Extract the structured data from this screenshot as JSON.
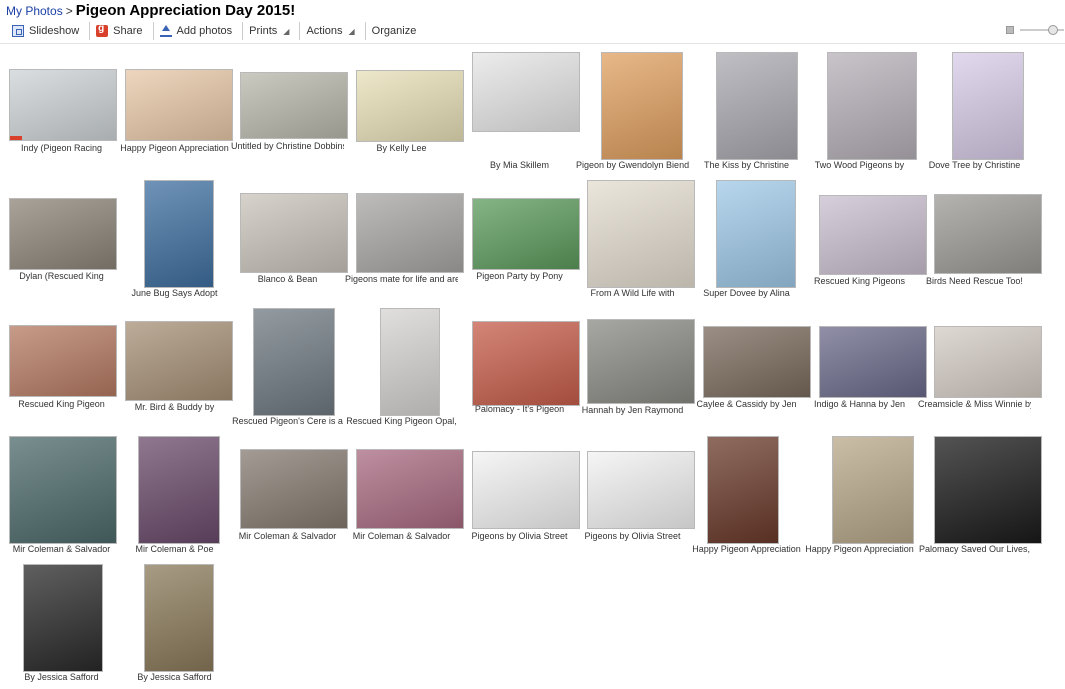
{
  "breadcrumb": {
    "root": "My Photos",
    "separator": ">",
    "album_title": "Pigeon Appreciation Day 2015!"
  },
  "toolbar": {
    "slideshow": "Slideshow",
    "share": "Share",
    "add_photos": "Add photos",
    "prints": "Prints",
    "actions": "Actions",
    "organize": "Organize"
  },
  "icons": {
    "slideshow": "slideshow-icon",
    "share": "google-plus-share-icon",
    "add_photos": "upload-icon",
    "thumb_small": "thumbnail-size-small-icon",
    "thumb_slider": "thumbnail-size-slider"
  },
  "colors": {
    "link": "#1a3fa6",
    "share_red": "#d8402b",
    "accent_blue": "#3a63b5"
  },
  "photos": [
    {
      "caption": "Indy (Pigeon Racing",
      "tone": "#cdd3d6"
    },
    {
      "caption": "Happy Pigeon Appreciation",
      "tone": "#e8c8a8"
    },
    {
      "caption": "Untitled by Christine Dobbins",
      "tone": "#b9b8ac"
    },
    {
      "caption": "By Kelly Lee",
      "tone": "#e8e0b8"
    },
    {
      "caption": "By Mia Skillem",
      "tone": "#e6e6e6"
    },
    {
      "caption": "Pigeon by Gwendolyn Biendl",
      "tone": "#e0a060"
    },
    {
      "caption": "The Kiss by Christine",
      "tone": "#a9a9b0"
    },
    {
      "caption": "Two Wood Pigeons by",
      "tone": "#b6b0b8"
    },
    {
      "caption": "Dove Tree by Christine",
      "tone": "#d8cce8"
    },
    {
      "caption": "Dylan (Rescued King",
      "tone": "#8c8478"
    },
    {
      "caption": "June Bug Says Adopt",
      "tone": "#3f6fa0"
    },
    {
      "caption": "Blanco & Bean",
      "tone": "#c9c3bb"
    },
    {
      "caption": "Pigeons mate for life and are",
      "tone": "#a8a6a4"
    },
    {
      "caption": "Pigeon Party by Pony",
      "tone": "#5c9a5c"
    },
    {
      "caption": "From A Wild Life with",
      "tone": "#e4ddd0"
    },
    {
      "caption": "Super Dovee by Alina",
      "tone": "#9fc9e8"
    },
    {
      "caption": "Rescued King Pigeons",
      "tone": "#c9bfcf"
    },
    {
      "caption": "Birds Need Rescue Too!",
      "tone": "#9b9a96"
    },
    {
      "caption": "Rescued King Pigeon",
      "tone": "#b57a62"
    },
    {
      "caption": "Mr. Bird & Buddy by",
      "tone": "#a69076"
    },
    {
      "caption": "Rescued Pigeon's Cere is a",
      "tone": "#6f7a82"
    },
    {
      "caption": "Rescued King Pigeon Opal,",
      "tone": "#d6d4d2"
    },
    {
      "caption": "Palomacy - It's Pigeon",
      "tone": "#c65d4a"
    },
    {
      "caption": "Hannah by Jen Raymond",
      "tone": "#8a8a84"
    },
    {
      "caption": "Caylee & Cassidy by Jen",
      "tone": "#7a6a5c"
    },
    {
      "caption": "Indigo & Hanna by Jen",
      "tone": "#6b6a8a"
    },
    {
      "caption": "Creamsicle & Miss Winnie by",
      "tone": "#d4ccc4"
    },
    {
      "caption": "Mir Coleman & Salvador",
      "tone": "#4d6a6a"
    },
    {
      "caption": "Mir Coleman & Poe",
      "tone": "#6a4a6a"
    },
    {
      "caption": "Mir Coleman & Salvador",
      "tone": "#857a70"
    },
    {
      "caption": "Mir Coleman & Salvador",
      "tone": "#a86a80"
    },
    {
      "caption": "Pigeons by Olivia Street",
      "tone": "#f2f2f2"
    },
    {
      "caption": "Pigeons by Olivia Street",
      "tone": "#f2f2f2"
    },
    {
      "caption": "Happy Pigeon Appreciation",
      "tone": "#6a3a2a"
    },
    {
      "caption": "Happy Pigeon Appreciation",
      "tone": "#b8a88a"
    },
    {
      "caption": "Palomacy Saved Our Lives,",
      "tone": "#1a1a1a"
    },
    {
      "caption": "By Jessica Safford",
      "tone": "#2a2a2a"
    },
    {
      "caption": "By Jessica Safford",
      "tone": "#8a7a5a"
    }
  ]
}
